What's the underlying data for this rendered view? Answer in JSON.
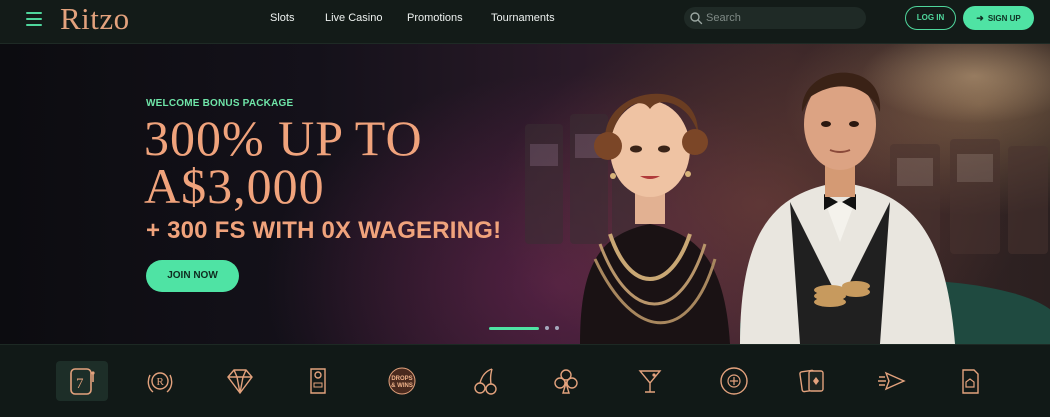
{
  "brand": {
    "logo": "Ritzo"
  },
  "nav": {
    "slots": "Slots",
    "live_casino": "Live Casino",
    "promotions": "Promotions",
    "tournaments": "Tournaments"
  },
  "search": {
    "placeholder": "Search"
  },
  "auth": {
    "login": "LOG IN",
    "signup": "SIGN UP"
  },
  "hero": {
    "eyebrow": "WELCOME BONUS PACKAGE",
    "headline_line1": "300% UP TO",
    "headline_line2": "A$3,000",
    "subline": "+ 300 FS WITH 0X WAGERING!",
    "cta": "JOIN NOW"
  },
  "carousel": {
    "slides": 3,
    "active": 1
  },
  "categories": {
    "drops_wins_line1": "DROPS",
    "drops_wins_line2": "& WINS",
    "items": [
      "slots-7-icon",
      "ritzo-crest-icon",
      "diamond-icon",
      "door-hanger-icon",
      "drops-wins-icon",
      "cherries-icon",
      "clubs-icon",
      "cocktail-icon",
      "poker-chip-icon",
      "playing-cards-icon",
      "arrow-fast-icon",
      "card-pocket-icon"
    ]
  },
  "colors": {
    "accent": "#4fe3a4",
    "gold": "#f0a37c",
    "bg": "#131b18"
  }
}
